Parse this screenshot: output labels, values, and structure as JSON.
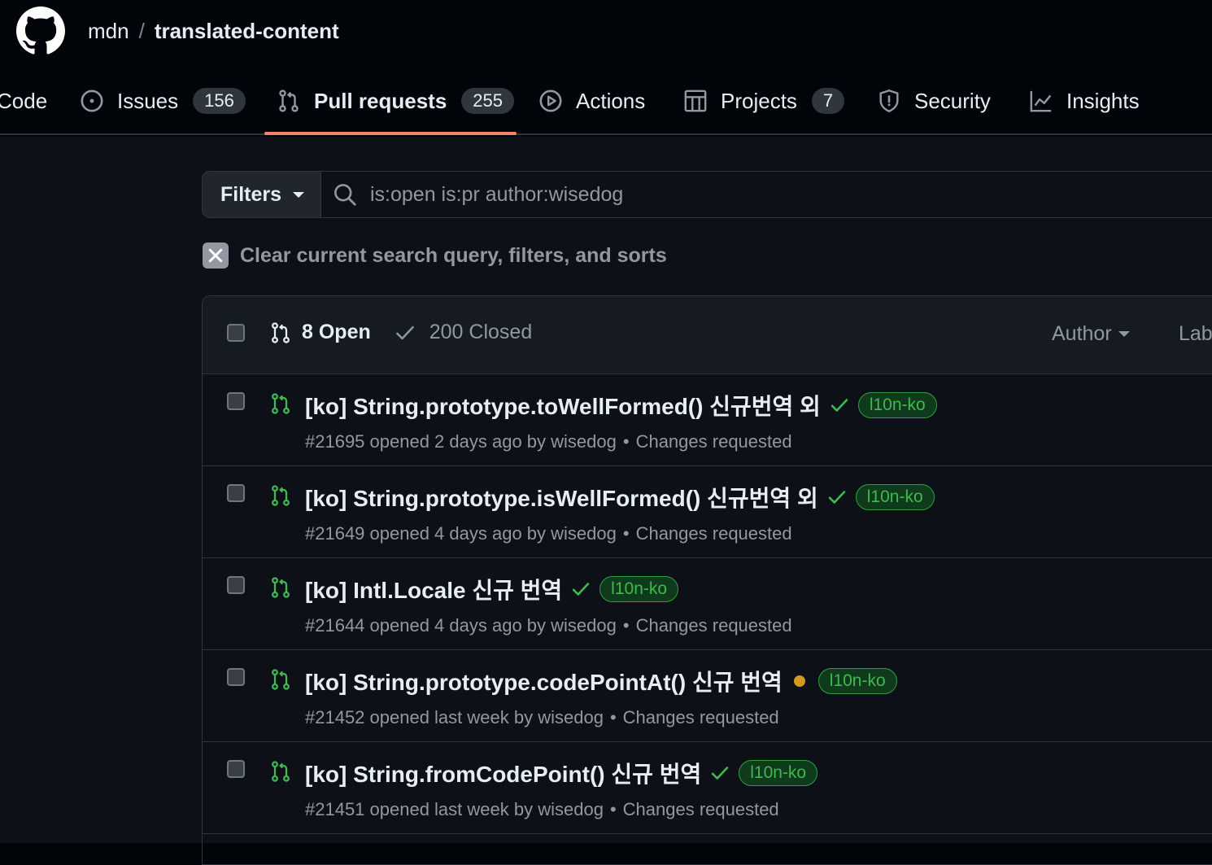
{
  "header": {
    "owner": "mdn",
    "separator": "/",
    "repo_name": "translated-content"
  },
  "tabs": [
    {
      "label": "Code",
      "icon": "code-icon"
    },
    {
      "label": "Issues",
      "count": "156",
      "icon": "issue-opened-icon"
    },
    {
      "label": "Pull requests",
      "count": "255",
      "icon": "git-pull-request-icon",
      "selected": true
    },
    {
      "label": "Actions",
      "icon": "play-icon"
    },
    {
      "label": "Projects",
      "count": "7",
      "icon": "table-icon"
    },
    {
      "label": "Security",
      "icon": "shield-icon"
    },
    {
      "label": "Insights",
      "icon": "graph-icon"
    }
  ],
  "filters": {
    "button_label": "Filters",
    "search_value": "is:open is:pr author:wisedog"
  },
  "clear_query": "Clear current search query, filters, and sorts",
  "list_header": {
    "open_label": "8 Open",
    "closed_label": "200 Closed",
    "author_label": "Author",
    "label_label": "Lab"
  },
  "pull_requests": [
    {
      "title": "[ko] String.prototype.toWellFormed() 신규번역 외",
      "status": "success",
      "label": "l10n-ko",
      "meta": "#21695 opened 2 days ago by wisedog",
      "review": "Changes requested"
    },
    {
      "title": "[ko] String.prototype.isWellFormed() 신규번역 외",
      "status": "success",
      "label": "l10n-ko",
      "meta": "#21649 opened 4 days ago by wisedog",
      "review": "Changes requested"
    },
    {
      "title": "[ko] Intl.Locale 신규 번역",
      "status": "success",
      "label": "l10n-ko",
      "meta": "#21644 opened 4 days ago by wisedog",
      "review": "Changes requested"
    },
    {
      "title": "[ko] String.prototype.codePointAt() 신규 번역",
      "status": "pending",
      "label": "l10n-ko",
      "meta": "#21452 opened last week by wisedog",
      "review": "Changes requested"
    },
    {
      "title": "[ko] String.fromCodePoint() 신규 번역",
      "status": "success",
      "label": "l10n-ko",
      "meta": "#21451 opened last week by wisedog",
      "review": "Changes requested"
    }
  ],
  "colors": {
    "accent_underline": "#f78166",
    "open_green": "#3fb950",
    "pending_yellow": "#d29922"
  }
}
